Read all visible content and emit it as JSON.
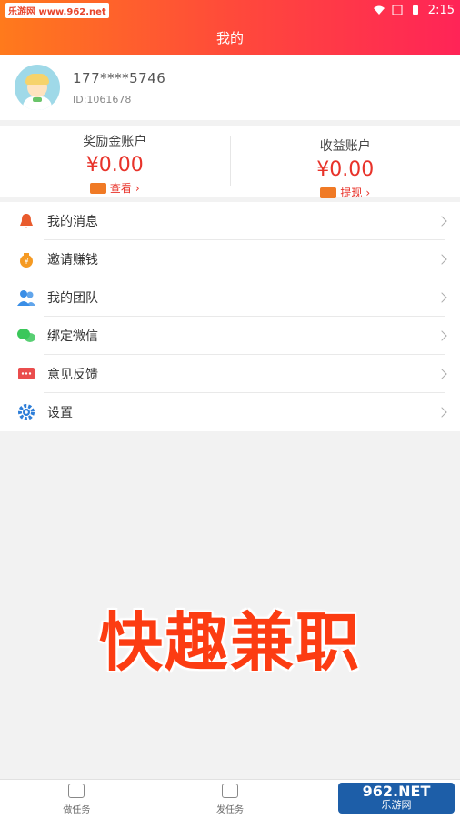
{
  "status": {
    "watermark": "乐游网 www.962.net",
    "time": "2:15"
  },
  "header": {
    "title": "我的"
  },
  "profile": {
    "phone": "177****5746",
    "id": "ID:1061678"
  },
  "accounts": [
    {
      "title": "奖励金账户",
      "amount": "¥0.00",
      "action": "查看"
    },
    {
      "title": "收益账户",
      "amount": "¥0.00",
      "action": "提现"
    }
  ],
  "menu": [
    {
      "label": "我的消息",
      "icon": "bell-icon",
      "color": "#e95b2d"
    },
    {
      "label": "邀请赚钱",
      "icon": "money-bag-icon",
      "color": "#f59a23"
    },
    {
      "label": "我的团队",
      "icon": "team-icon",
      "color": "#3a8ee6"
    },
    {
      "label": "绑定微信",
      "icon": "wechat-icon",
      "color": "#3bc75a"
    },
    {
      "label": "意见反馈",
      "icon": "feedback-icon",
      "color": "#ea4d4d"
    },
    {
      "label": "设置",
      "icon": "gear-icon",
      "color": "#2e7ed8"
    }
  ],
  "watermark_text": "快趣兼职",
  "tabs": [
    {
      "label": "做任务",
      "icon": "clipboard-icon"
    },
    {
      "label": "发任务",
      "icon": "post-task-icon"
    }
  ],
  "logo": {
    "main": "962.NET",
    "sub": "乐游网"
  }
}
